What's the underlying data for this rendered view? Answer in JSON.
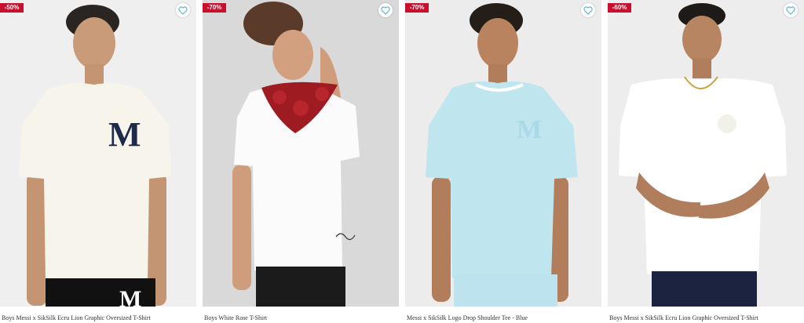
{
  "products": [
    {
      "discount": "-50%",
      "title": "Boys Messi x SikSilk Ecru Lion Graphic Oversized T-Shirt",
      "shirt_color": "#f7f4ec",
      "bg": "#efefef"
    },
    {
      "discount": "-70%",
      "title": "Boys White Rose T-Shirt",
      "shirt_color": "#fbfbfb",
      "bg": "#d9d9d9"
    },
    {
      "discount": "-70%",
      "title": "Messi x SikSilk Logo Drop Shoulder Tee - Blue",
      "shirt_color": "#bfe6ef",
      "bg": "#ececec"
    },
    {
      "discount": "-60%",
      "title": "Boys Messi x SikSilk Ecru Lion Graphic Oversized T-Shirt",
      "shirt_color": "#ffffff",
      "bg": "#ededed"
    }
  ],
  "icons": {
    "wishlist": "heart-outline-icon"
  },
  "colors": {
    "badge": "#c8102e",
    "heart": "#5bb8d3"
  }
}
